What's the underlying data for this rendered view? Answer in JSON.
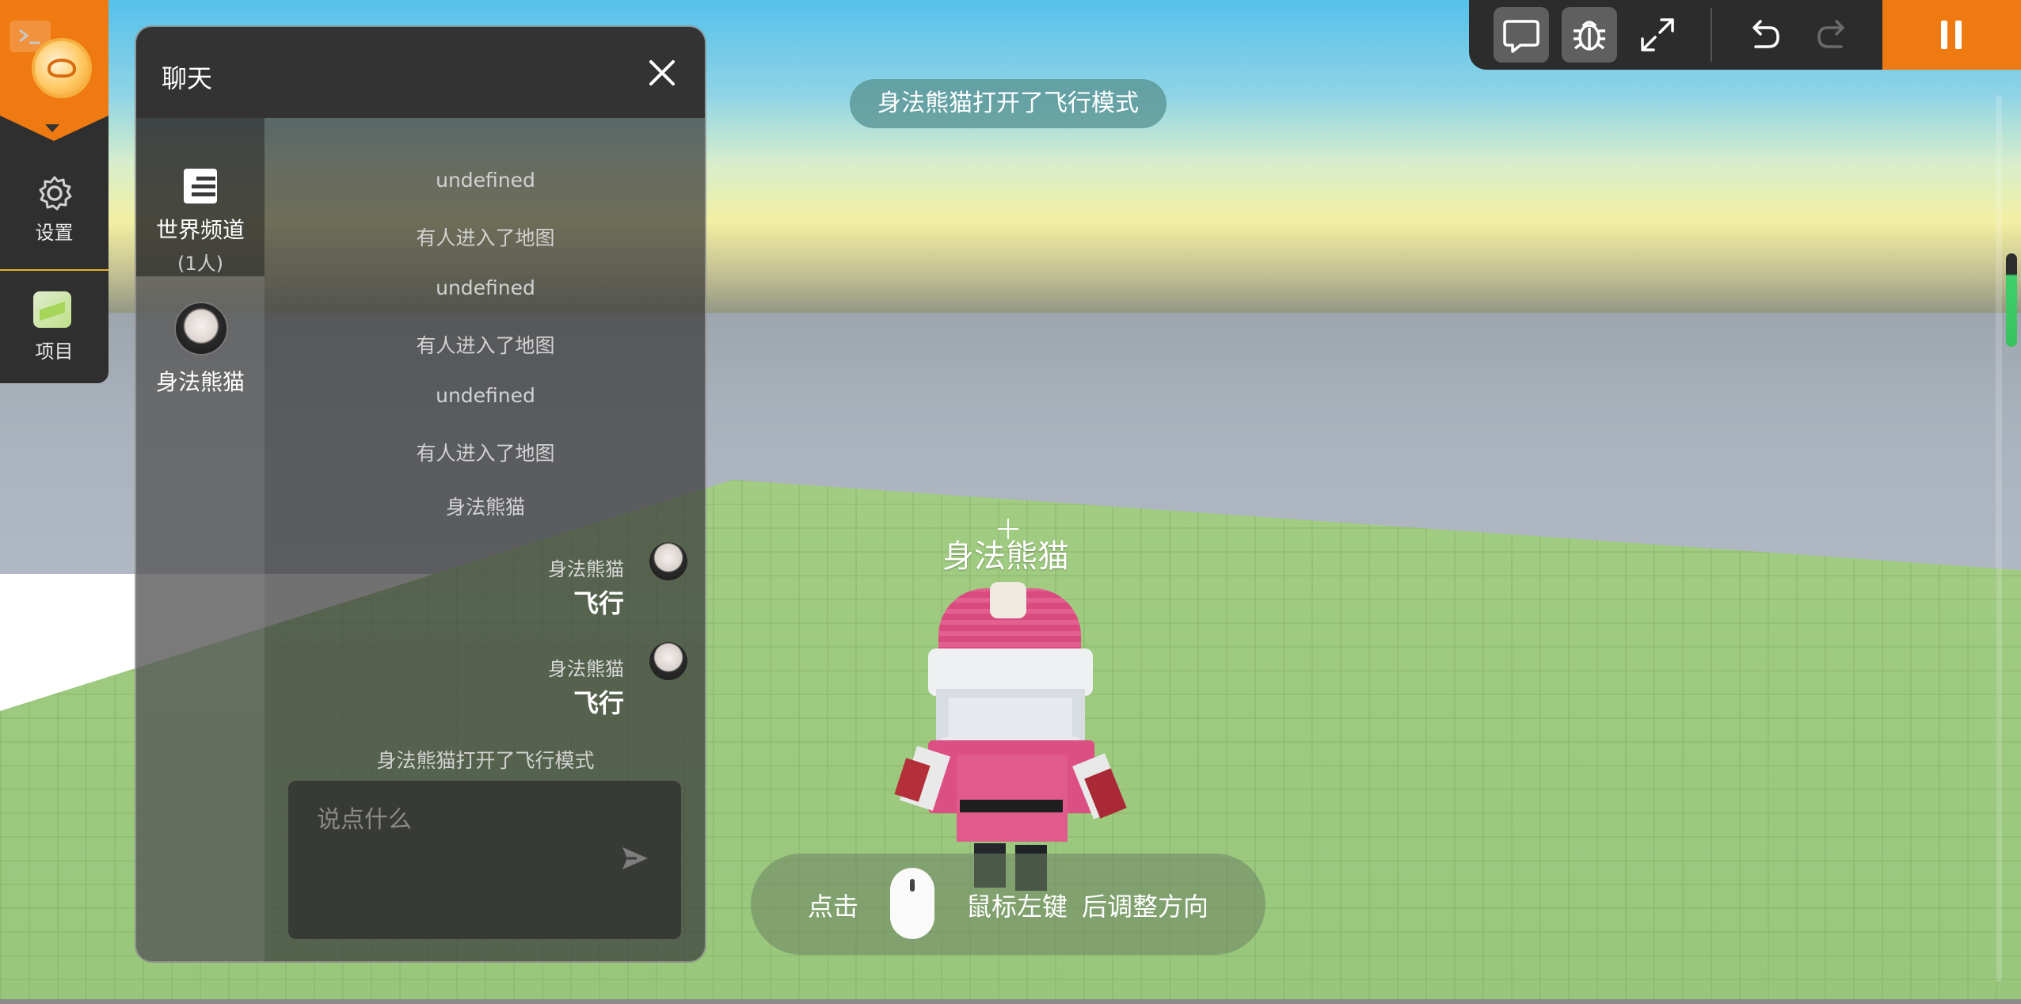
{
  "nav": {
    "settings_label": "设置",
    "project_label": "项目"
  },
  "chat": {
    "title": "聊天",
    "world_channel": {
      "name": "世界频道",
      "count": "(1人)"
    },
    "user_channel": {
      "name": "身法熊猫"
    },
    "system_messages": [
      "undefined",
      "有人进入了地图",
      "undefined",
      "有人进入了地图",
      "undefined",
      "有人进入了地图",
      "身法熊猫"
    ],
    "user_messages": [
      {
        "name": "身法熊猫",
        "text": "飞行"
      },
      {
        "name": "身法熊猫",
        "text": "飞行"
      }
    ],
    "final_system_message": "身法熊猫打开了飞行模式",
    "input_placeholder": "说点什么"
  },
  "toast": "身法熊猫打开了飞行模式",
  "player_name": "身法熊猫",
  "hint": {
    "prefix": "点击",
    "action": "鼠标左键",
    "suffix": "后调整方向"
  },
  "icons": {
    "toolbar": [
      "chat-icon",
      "bug-icon",
      "expand-icon",
      "undo-icon",
      "redo-icon",
      "pause-icon"
    ],
    "brand_accent": "#f07a12"
  }
}
